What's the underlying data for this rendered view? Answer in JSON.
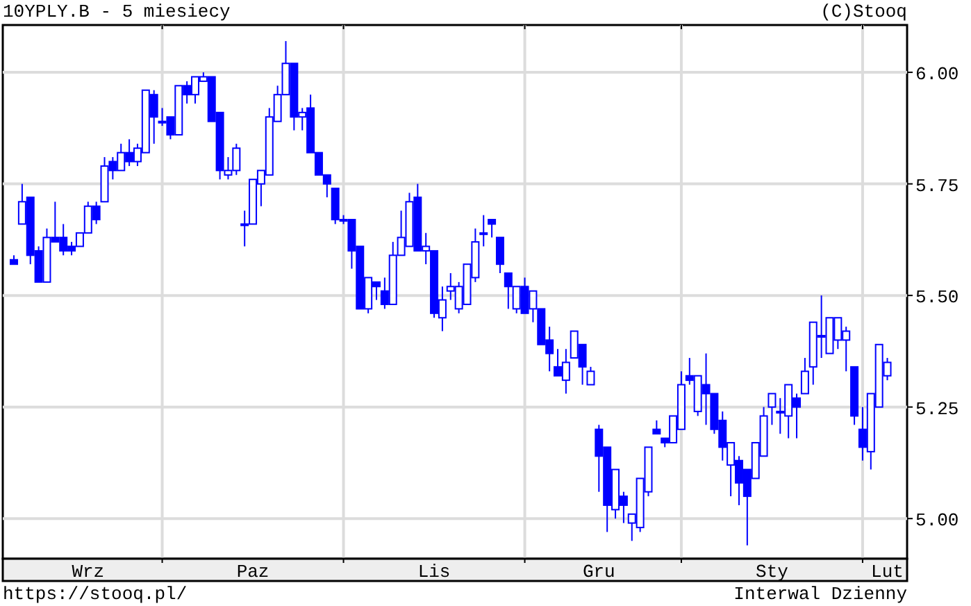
{
  "header": {
    "title": "10YPLY.B - 5 miesiecy",
    "copyright": "(C)Stooq"
  },
  "chart": {
    "chart_data": {
      "type": "candlestick",
      "grid": true,
      "ylim": [
        4.91,
        6.106
      ],
      "yticks": [
        {
          "value": 5.0,
          "label": "5.00"
        },
        {
          "value": 5.25,
          "label": "5.25"
        },
        {
          "value": 5.5,
          "label": "5.50"
        },
        {
          "value": 5.75,
          "label": "5.75"
        },
        {
          "value": 6.0,
          "label": "6.00"
        }
      ],
      "categories": [
        null,
        null,
        null,
        null,
        null,
        null,
        null,
        null,
        null,
        "Wrz",
        null,
        null,
        null,
        null,
        null,
        null,
        null,
        null,
        null,
        null,
        null,
        null,
        null,
        null,
        null,
        null,
        null,
        null,
        null,
        "Paz",
        null,
        null,
        null,
        null,
        null,
        null,
        null,
        null,
        null,
        null,
        null,
        null,
        null,
        null,
        null,
        null,
        null,
        null,
        null,
        null,
        null,
        "Lis",
        null,
        null,
        null,
        null,
        null,
        null,
        null,
        null,
        null,
        null,
        null,
        null,
        null,
        null,
        null,
        null,
        null,
        null,
        null,
        "Gru",
        null,
        null,
        null,
        null,
        null,
        null,
        null,
        null,
        null,
        null,
        null,
        null,
        null,
        null,
        null,
        null,
        null,
        null,
        null,
        null,
        "Sty",
        null,
        null,
        null,
        null,
        null,
        null,
        null,
        null,
        null,
        null,
        null,
        null,
        null,
        "Lut"
      ],
      "ohlc": [
        [
          5.58,
          5.59,
          5.57,
          5.57
        ],
        [
          5.66,
          5.75,
          5.66,
          5.71
        ],
        [
          5.72,
          5.72,
          5.57,
          5.59
        ],
        [
          5.6,
          5.61,
          5.53,
          5.53
        ],
        [
          5.53,
          5.65,
          5.53,
          5.63
        ],
        [
          5.63,
          5.71,
          5.62,
          5.62
        ],
        [
          5.63,
          5.66,
          5.59,
          5.6
        ],
        [
          5.61,
          5.62,
          5.59,
          5.6
        ],
        [
          5.61,
          5.64,
          5.61,
          5.64
        ],
        [
          5.64,
          5.71,
          5.64,
          5.7
        ],
        [
          5.7,
          5.71,
          5.66,
          5.67
        ],
        [
          5.71,
          5.81,
          5.71,
          5.79
        ],
        [
          5.8,
          5.81,
          5.76,
          5.78
        ],
        [
          5.78,
          5.84,
          5.78,
          5.82
        ],
        [
          5.82,
          5.85,
          5.79,
          5.8
        ],
        [
          5.8,
          5.84,
          5.79,
          5.83
        ],
        [
          5.82,
          5.96,
          5.82,
          5.96
        ],
        [
          5.95,
          5.96,
          5.84,
          5.9
        ],
        [
          5.89,
          5.92,
          5.88,
          5.89
        ],
        [
          5.9,
          5.9,
          5.85,
          5.86
        ],
        [
          5.86,
          5.97,
          5.86,
          5.97
        ],
        [
          5.97,
          5.98,
          5.93,
          5.95
        ],
        [
          5.95,
          5.99,
          5.93,
          5.99
        ],
        [
          5.98,
          6.0,
          5.98,
          5.99
        ],
        [
          5.99,
          5.99,
          5.89,
          5.89
        ],
        [
          5.91,
          5.91,
          5.76,
          5.78
        ],
        [
          5.77,
          5.81,
          5.76,
          5.78
        ],
        [
          5.78,
          5.84,
          5.77,
          5.83
        ],
        [
          5.66,
          5.69,
          5.61,
          5.66
        ],
        [
          5.66,
          5.76,
          5.66,
          5.76
        ],
        [
          5.75,
          5.78,
          5.7,
          5.78
        ],
        [
          5.77,
          5.92,
          5.77,
          5.9
        ],
        [
          5.89,
          5.97,
          5.89,
          5.95
        ],
        [
          5.95,
          6.07,
          5.95,
          6.02
        ],
        [
          6.02,
          6.02,
          5.87,
          5.9
        ],
        [
          5.9,
          5.92,
          5.87,
          5.91
        ],
        [
          5.92,
          5.95,
          5.82,
          5.82
        ],
        [
          5.82,
          5.82,
          5.77,
          5.77
        ],
        [
          5.77,
          5.77,
          5.72,
          5.75
        ],
        [
          5.74,
          5.74,
          5.66,
          5.67
        ],
        [
          5.67,
          5.68,
          5.66,
          5.67
        ],
        [
          5.67,
          5.67,
          5.56,
          5.6
        ],
        [
          5.61,
          5.61,
          5.47,
          5.47
        ],
        [
          5.47,
          5.54,
          5.46,
          5.54
        ],
        [
          5.53,
          5.53,
          5.49,
          5.52
        ],
        [
          5.51,
          5.54,
          5.47,
          5.48
        ],
        [
          5.48,
          5.62,
          5.48,
          5.59
        ],
        [
          5.59,
          5.69,
          5.59,
          5.63
        ],
        [
          5.61,
          5.73,
          5.61,
          5.71
        ],
        [
          5.72,
          5.75,
          5.6,
          5.6
        ],
        [
          5.6,
          5.64,
          5.57,
          5.61
        ],
        [
          5.6,
          5.6,
          5.45,
          5.46
        ],
        [
          5.45,
          5.52,
          5.42,
          5.49
        ],
        [
          5.51,
          5.55,
          5.49,
          5.52
        ],
        [
          5.47,
          5.53,
          5.46,
          5.52
        ],
        [
          5.48,
          5.57,
          5.48,
          5.57
        ],
        [
          5.54,
          5.65,
          5.53,
          5.62
        ],
        [
          5.64,
          5.68,
          5.61,
          5.64
        ],
        [
          5.67,
          5.67,
          5.63,
          5.66
        ],
        [
          5.63,
          5.63,
          5.55,
          5.57
        ],
        [
          5.55,
          5.55,
          5.47,
          5.52
        ],
        [
          5.47,
          5.52,
          5.46,
          5.52
        ],
        [
          5.52,
          5.54,
          5.46,
          5.46
        ],
        [
          5.47,
          5.51,
          5.44,
          5.51
        ],
        [
          5.47,
          5.47,
          5.39,
          5.39
        ],
        [
          5.4,
          5.43,
          5.33,
          5.37
        ],
        [
          5.34,
          5.38,
          5.32,
          5.32
        ],
        [
          5.31,
          5.38,
          5.28,
          5.35
        ],
        [
          5.36,
          5.42,
          5.36,
          5.42
        ],
        [
          5.39,
          5.39,
          5.3,
          5.34
        ],
        [
          5.3,
          5.34,
          5.3,
          5.33
        ],
        [
          5.2,
          5.21,
          5.06,
          5.14
        ],
        [
          5.16,
          5.16,
          4.97,
          5.03
        ],
        [
          5.02,
          5.11,
          5.0,
          5.11
        ],
        [
          5.05,
          5.06,
          4.99,
          5.03
        ],
        [
          4.99,
          5.01,
          4.95,
          5.01
        ],
        [
          4.98,
          5.09,
          4.97,
          5.09
        ],
        [
          5.06,
          5.16,
          5.05,
          5.16
        ],
        [
          5.2,
          5.22,
          5.19,
          5.19
        ],
        [
          5.18,
          5.18,
          5.16,
          5.17
        ],
        [
          5.17,
          5.23,
          5.17,
          5.23
        ],
        [
          5.2,
          5.33,
          5.2,
          5.3
        ],
        [
          5.32,
          5.36,
          5.3,
          5.31
        ],
        [
          5.24,
          5.32,
          5.23,
          5.32
        ],
        [
          5.3,
          5.37,
          5.21,
          5.28
        ],
        [
          5.28,
          5.28,
          5.19,
          5.2
        ],
        [
          5.22,
          5.24,
          5.13,
          5.16
        ],
        [
          5.12,
          5.17,
          5.05,
          5.17
        ],
        [
          5.13,
          5.14,
          5.03,
          5.08
        ],
        [
          5.11,
          5.11,
          4.94,
          5.05
        ],
        [
          5.09,
          5.17,
          5.09,
          5.17
        ],
        [
          5.14,
          5.25,
          5.14,
          5.23
        ],
        [
          5.25,
          5.28,
          5.21,
          5.28
        ],
        [
          5.24,
          5.27,
          5.19,
          5.24
        ],
        [
          5.23,
          5.3,
          5.18,
          5.3
        ],
        [
          5.27,
          5.28,
          5.18,
          5.25
        ],
        [
          5.28,
          5.36,
          5.28,
          5.33
        ],
        [
          5.34,
          5.44,
          5.3,
          5.44
        ],
        [
          5.41,
          5.5,
          5.36,
          5.41
        ],
        [
          5.37,
          5.45,
          5.37,
          5.45
        ],
        [
          5.4,
          5.45,
          5.38,
          5.45
        ],
        [
          5.4,
          5.43,
          5.33,
          5.42
        ],
        [
          5.34,
          5.34,
          5.21,
          5.23
        ],
        [
          5.2,
          5.25,
          5.13,
          5.16
        ],
        [
          5.15,
          5.28,
          5.11,
          5.28
        ],
        [
          5.25,
          5.39,
          5.25,
          5.39
        ],
        [
          5.32,
          5.36,
          5.31,
          5.35
        ]
      ]
    }
  },
  "footer": {
    "url": "https://stooq.pl/",
    "interval": "Interwal Dzienny"
  }
}
